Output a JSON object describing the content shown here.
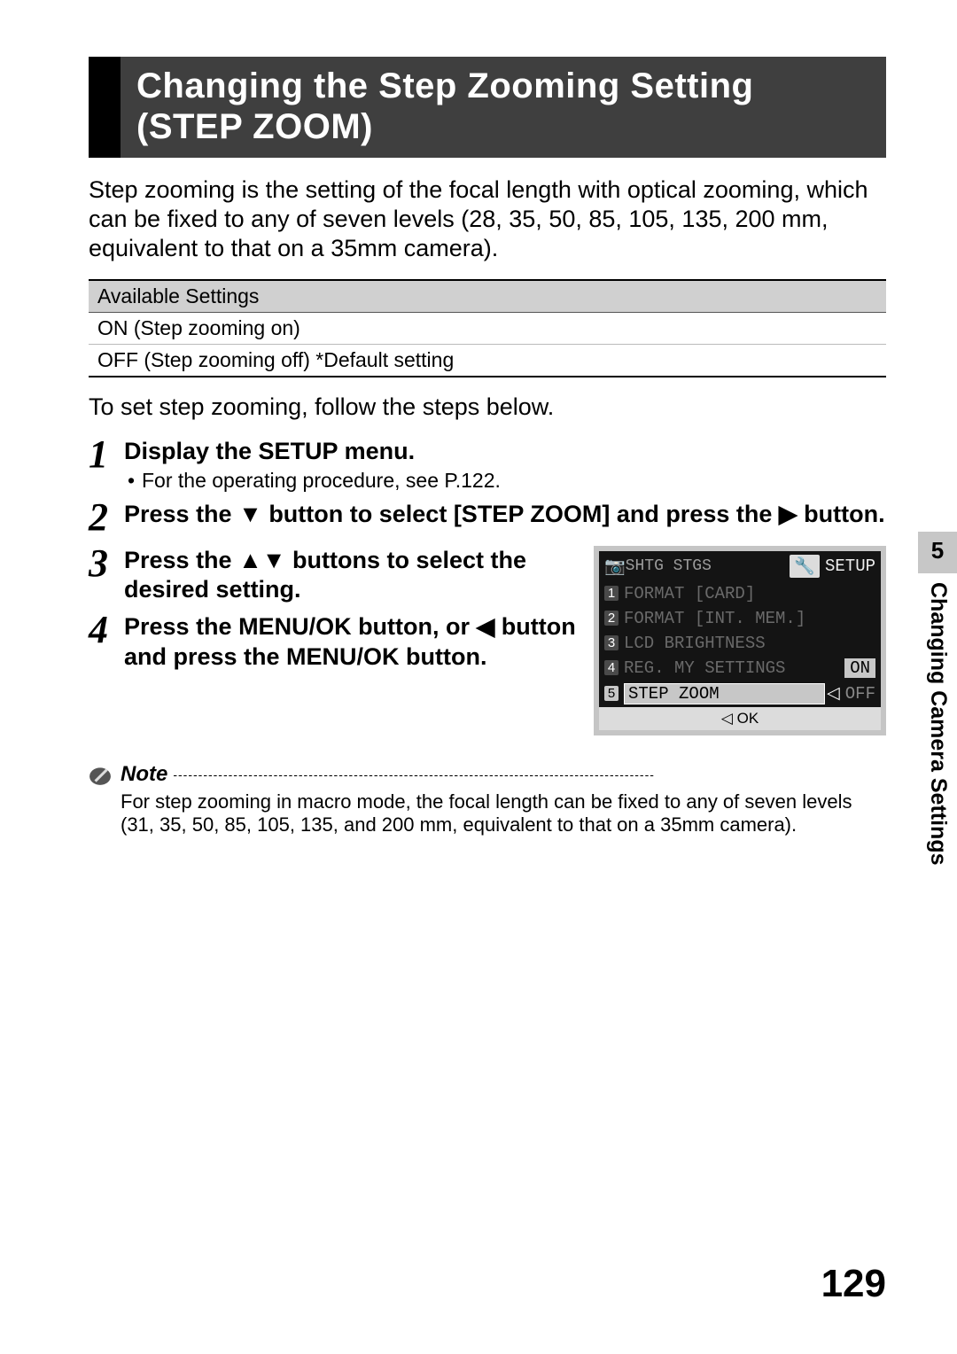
{
  "title_line1": "Changing the Step Zooming Setting",
  "title_line2": "(STEP ZOOM)",
  "intro": "Step zooming is the setting of the focal length with optical zooming, which can be fixed to any of seven levels (28, 35, 50, 85, 105, 135, 200 mm, equivalent to that on a 35mm camera).",
  "table": {
    "header": "Available Settings",
    "rows": [
      "ON (Step zooming on)",
      "OFF (Step zooming off) *Default setting"
    ]
  },
  "lead": "To set step zooming, follow the steps below.",
  "steps": {
    "s1": {
      "num": "1",
      "title": "Display the SETUP menu.",
      "sub": "For the operating procedure, see P.122."
    },
    "s2": {
      "num": "2",
      "t_pre": "Press the ",
      "t_mid": " button to select [STEP ZOOM] and press the ",
      "t_post": " button."
    },
    "s3": {
      "num": "3",
      "t_pre": "Press the ",
      "t_post": " buttons to select the desired setting."
    },
    "s4": {
      "num": "4",
      "t_pre": "Press the MENU/OK button, or ",
      "t_post": " button and press the MENU/OK button."
    }
  },
  "note": {
    "label": "Note",
    "body": "For step zooming in macro mode, the focal length can be fixed to any of seven levels (31, 35, 50, 85, 105, 135, and 200 mm, equivalent to that on a 35mm camera)."
  },
  "side": {
    "chapter": "5",
    "label": "Changing Camera Settings"
  },
  "page_number": "129",
  "lcd": {
    "tabs_left": "SHTG STGS",
    "setup_label": "SETUP",
    "rows": [
      {
        "n": "1",
        "label": "FORMAT [CARD]",
        "val": ""
      },
      {
        "n": "2",
        "label": "FORMAT [INT. MEM.]",
        "val": ""
      },
      {
        "n": "3",
        "label": "LCD BRIGHTNESS",
        "val": ""
      },
      {
        "n": "4",
        "label": "REG. MY SETTINGS",
        "val": "ON"
      },
      {
        "n": "5",
        "label": "STEP ZOOM",
        "val": "OFF"
      }
    ],
    "footer": "◁ OK"
  }
}
